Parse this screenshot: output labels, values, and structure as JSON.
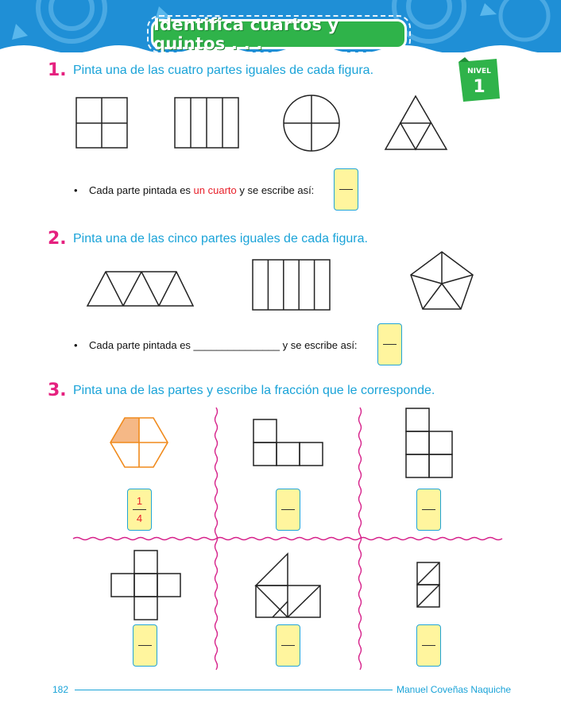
{
  "header": {
    "title": "Identifica cuartos y quintos . . ."
  },
  "badge": {
    "label": "NIVEL",
    "number": "1"
  },
  "exercise1": {
    "number": "1.",
    "instruction": "Pinta una de las cuatro partes iguales de cada figura.",
    "bullet_before": "Cada parte pintada es ",
    "bullet_highlight": "un cuarto",
    "bullet_after": " y se escribe así:"
  },
  "exercise2": {
    "number": "2.",
    "instruction": "Pinta una de las cinco partes iguales de cada figura.",
    "bullet_before": "Cada parte pintada es ",
    "bullet_blank": "_______________",
    "bullet_after": " y se escribe así:"
  },
  "exercise3": {
    "number": "3.",
    "instruction": "Pinta una de las partes y escribe la fracción que le corresponde.",
    "example_numerator": "1",
    "example_denominator": "4"
  },
  "footer": {
    "page_number": "182",
    "author": "Manuel Coveñas Naquiche"
  },
  "colors": {
    "heading_blue": "#1aa3d8",
    "number_pink": "#e5217f",
    "banner_blue": "#1f8fd6",
    "pill_green": "#2fb34a",
    "answer_box_fill": "#fff59e",
    "highlight_red": "#e8202a",
    "hexagon_orange": "#f08a1c",
    "divider_magenta": "#d6218a"
  }
}
